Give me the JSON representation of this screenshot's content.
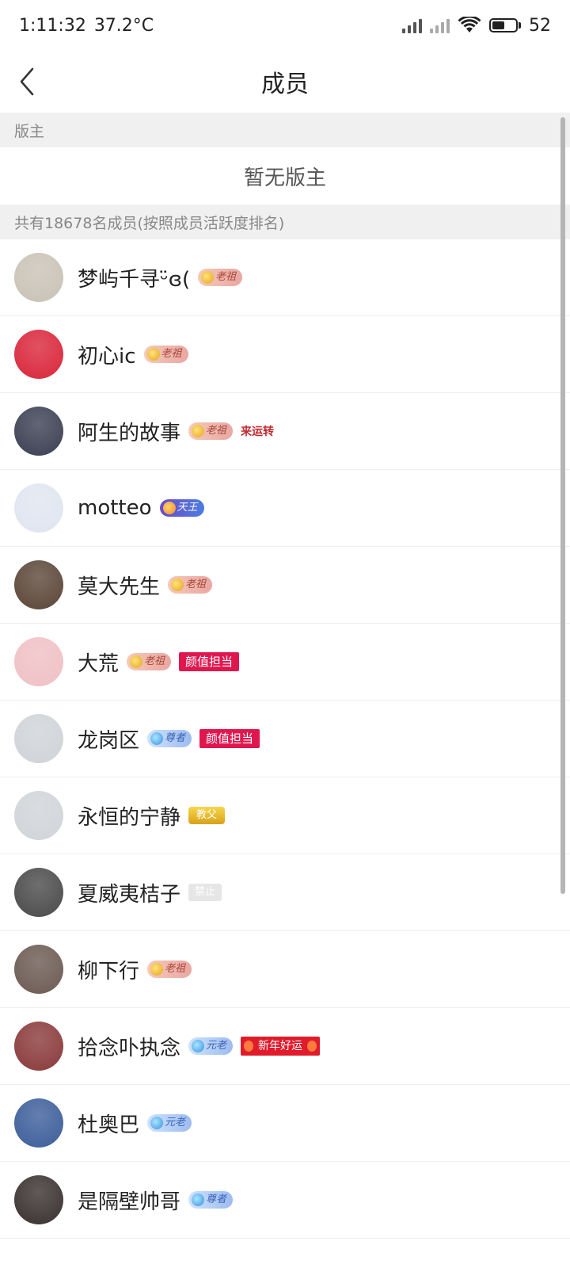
{
  "status_bar": {
    "time": "1:11:32",
    "temperature": "37.2°C",
    "battery": "52",
    "battery_level": 0.52
  },
  "nav": {
    "title": "成员"
  },
  "sections": {
    "moderators_header": "版主",
    "moderators_empty": "暂无版主",
    "members_header": "共有18678名成员(按照成员活跃度排名)"
  },
  "members": [
    {
      "name": "梦屿千寻ᵕ̈ɞ(",
      "badge": "老祖",
      "badge_style": "gold",
      "avatar_color": "#c9c2b6"
    },
    {
      "name": "初心ic",
      "badge": "老祖",
      "badge_style": "gold",
      "avatar_color": "#d9263a"
    },
    {
      "name": "阿生的故事",
      "badge": "老祖",
      "badge_style": "gold",
      "extra_tag": "来运转",
      "extra_style": "laiyun",
      "avatar_color": "#3b3f52"
    },
    {
      "name": "motteo",
      "badge": "天王",
      "badge_style": "purple",
      "avatar_color": "#dfe5f0"
    },
    {
      "name": "莫大先生",
      "badge": "老祖",
      "badge_style": "gold",
      "avatar_color": "#5b4638"
    },
    {
      "name": "大荒",
      "badge": "老祖",
      "badge_style": "gold",
      "extra_tag": "颜值担当",
      "extra_style": "red",
      "avatar_color": "#efc0c4"
    },
    {
      "name": "龙岗区",
      "badge": "尊者",
      "badge_style": "blue",
      "extra_tag": "颜值担当",
      "extra_style": "red",
      "avatar_color": "#cfd3d8"
    },
    {
      "name": "永恒的宁静",
      "badge": "教父",
      "badge_style": "flat-gold",
      "avatar_color": "#d0d4d8"
    },
    {
      "name": "夏威夷桔子",
      "badge": "禁止",
      "badge_style": "grey",
      "avatar_color": "#4a4a4a"
    },
    {
      "name": "柳下行",
      "badge": "老祖",
      "badge_style": "gold",
      "avatar_color": "#6b5a52"
    },
    {
      "name": "拾念卟执念",
      "badge": "元老",
      "badge_style": "blue",
      "extra_tag": "新年好运",
      "extra_style": "newyear",
      "avatar_color": "#8a3a3a"
    },
    {
      "name": "杜奥巴",
      "badge": "元老",
      "badge_style": "blue",
      "avatar_color": "#3c5e9a"
    },
    {
      "name": "是隔壁帅哥",
      "badge": "尊者",
      "badge_style": "blue",
      "avatar_color": "#3a3030"
    }
  ],
  "icons": {
    "back": "chevron-left-icon",
    "wifi": "wifi-icon",
    "signal": "signal-icon",
    "battery": "battery-icon"
  }
}
